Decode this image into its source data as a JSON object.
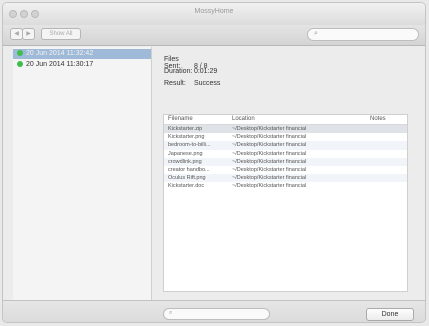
{
  "window": {
    "title": "MossyHome"
  },
  "toolbar": {
    "back": "◀",
    "forward": "▶",
    "show_all": "Show All",
    "search_placeholder": ""
  },
  "sidebar": {
    "items": [
      {
        "label": "20 Jun 2014 11:32:42",
        "selected": true
      },
      {
        "label": "20 Jun 2014 11:30:17",
        "selected": false
      }
    ]
  },
  "summary": {
    "files_sent_label": "Files Sent:",
    "files_sent_value": "8 / 8",
    "duration_label": "Duration:",
    "duration_value": "0:01:29",
    "result_label": "Result:",
    "result_value": "Success"
  },
  "table": {
    "headers": {
      "filename": "Filename",
      "location": "Location",
      "notes": "Notes"
    },
    "rows": [
      {
        "filename": "Kickstarter.zip",
        "location": "~/Desktop/Kickstarter financial"
      },
      {
        "filename": "Kickstarter.png",
        "location": "~/Desktop/Kickstarter financial"
      },
      {
        "filename": "bedroom-to-billi...",
        "location": "~/Desktop/Kickstarter financial"
      },
      {
        "filename": "Japanese.png",
        "location": "~/Desktop/Kickstarter financial"
      },
      {
        "filename": "crowdlink.png",
        "location": "~/Desktop/Kickstarter financial"
      },
      {
        "filename": "creator handbo...",
        "location": "~/Desktop/Kickstarter financial"
      },
      {
        "filename": "Oculus Rift.png",
        "location": "~/Desktop/Kickstarter financial"
      },
      {
        "filename": "Kickstarter.doc",
        "location": "~/Desktop/Kickstarter financial"
      }
    ]
  },
  "bottom": {
    "search_placeholder": "",
    "done_label": "Done"
  },
  "colors": {
    "accent_selection": "#9fb9d8",
    "status_green": "#3fbf4a"
  }
}
